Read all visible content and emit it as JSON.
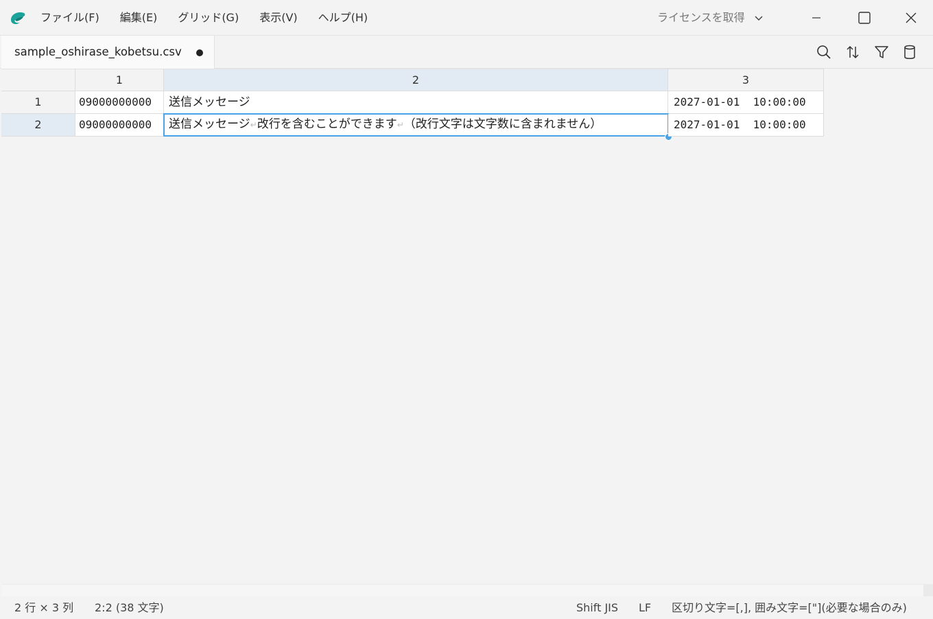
{
  "menu": {
    "file": "ファイル(F)",
    "edit": "編集(E)",
    "grid": "グリッド(G)",
    "view": "表示(V)",
    "help": "ヘルプ(H)"
  },
  "license_label": "ライセンスを取得",
  "tab": {
    "filename": "sample_oshirase_kobetsu.csv"
  },
  "grid": {
    "column_headers": [
      "1",
      "2",
      "3"
    ],
    "rows": [
      {
        "header": "1",
        "cells": [
          "09000000000",
          "送信メッセージ",
          "2027-01-01  10:00:00"
        ]
      },
      {
        "header": "2",
        "cells": [
          "09000000000",
          null,
          "2027-01-01  10:00:00"
        ],
        "message_parts": [
          "送信メッセージ",
          "改行を含むことができます",
          "（改行文字は文字数に含まれません）"
        ],
        "newline_glyph": "↵"
      }
    ],
    "selected_cell": "2:2"
  },
  "status": {
    "dimensions": "2 行 × 3 列",
    "position": "2:2 (38 文字)",
    "encoding": "Shift JIS",
    "line_ending": "LF",
    "delimiter": "区切り文字=[,], 囲み文字=[\"](必要な場合のみ)"
  },
  "colors": {
    "accent": "#4aa3e6",
    "header_active": "#e2eaf3",
    "app_icon": "#1aa39a"
  }
}
